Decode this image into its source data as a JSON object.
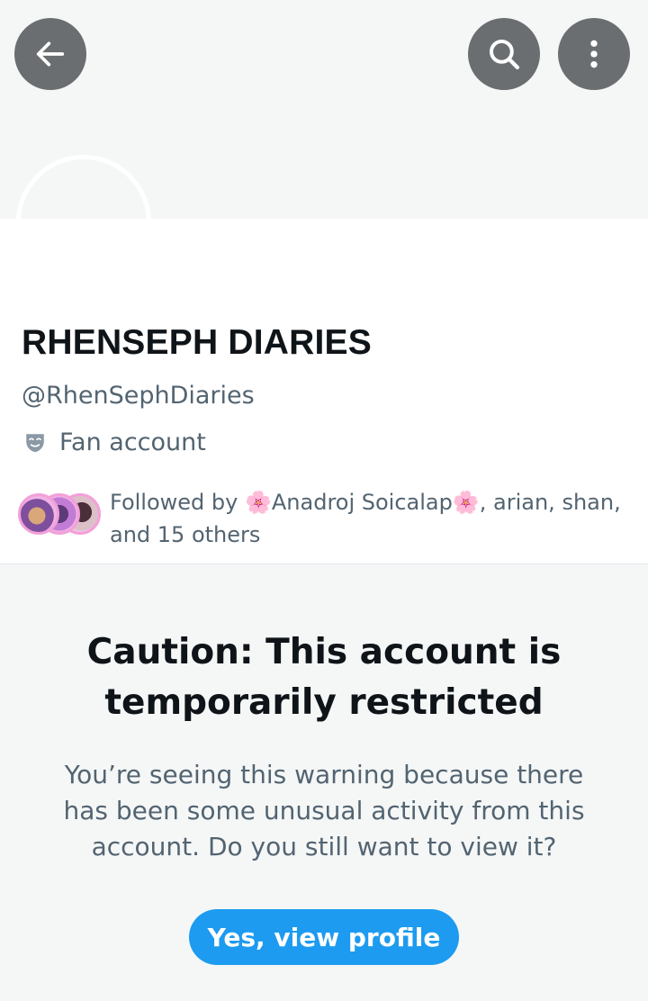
{
  "header": {
    "back_icon": "arrow-left-icon",
    "search_icon": "search-icon",
    "more_icon": "more-vertical-icon"
  },
  "profile": {
    "display_name": "RHENSEPH DIARIES",
    "handle": "@RhenSephDiaries",
    "category_icon": "theater-mask-icon",
    "category": "Fan account",
    "followed_by": {
      "prefix": "Followed by ",
      "name1": "Anadroj Soicalap",
      "separator": ", arian, shan,",
      "suffix": "and 15 others",
      "flower_icon": "🌸"
    }
  },
  "warning": {
    "title": "Caution: This account is temporarily restricted",
    "body": "You’re seeing this warning because there has been some unusual activity from this account. Do you still want to view it?",
    "button_label": "Yes, view profile"
  },
  "colors": {
    "accent": "#1d9bf0",
    "banner": "#f5f7f7",
    "secondary_text": "#536471",
    "primary_text": "#0f1419",
    "icon_button": "#6b6e71"
  }
}
